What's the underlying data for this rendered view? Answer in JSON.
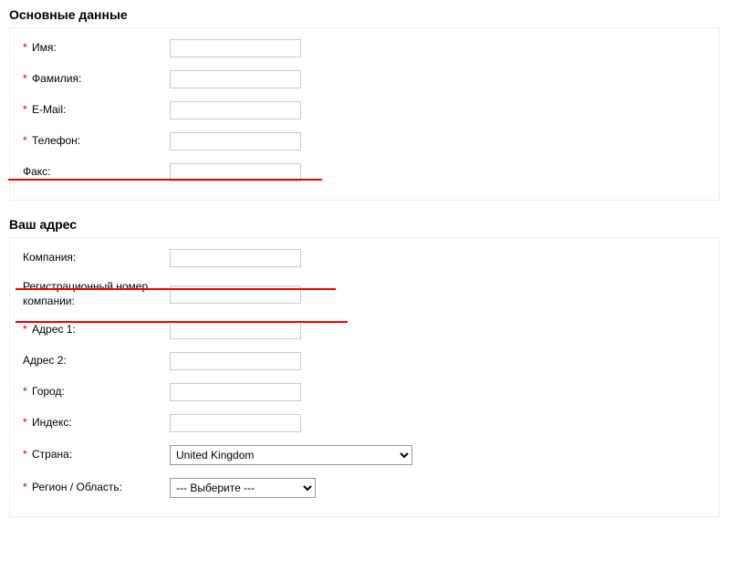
{
  "sections": {
    "basic": {
      "heading": "Основные данные",
      "rows": [
        {
          "required": true,
          "label": "Имя:"
        },
        {
          "required": true,
          "label": "Фамилия:"
        },
        {
          "required": true,
          "label": "E-Mail:"
        },
        {
          "required": true,
          "label": "Телефон:"
        },
        {
          "required": false,
          "label": "Факс:"
        }
      ]
    },
    "address": {
      "heading": "Ваш адрес",
      "rows": [
        {
          "required": false,
          "label": "Компания:"
        },
        {
          "required": false,
          "label": "Регистрационный номер компании:"
        },
        {
          "required": true,
          "label": "Адрес 1:"
        },
        {
          "required": false,
          "label": "Адрес 2:"
        },
        {
          "required": true,
          "label": "Город:"
        },
        {
          "required": true,
          "label": "Индекс:"
        },
        {
          "required": true,
          "label": "Страна:",
          "type": "select-wide",
          "value": "United Kingdom"
        },
        {
          "required": true,
          "label": "Регион / Область:",
          "type": "select-narrow",
          "value": "--- Выберите ---"
        }
      ]
    }
  },
  "required_marker": "*"
}
